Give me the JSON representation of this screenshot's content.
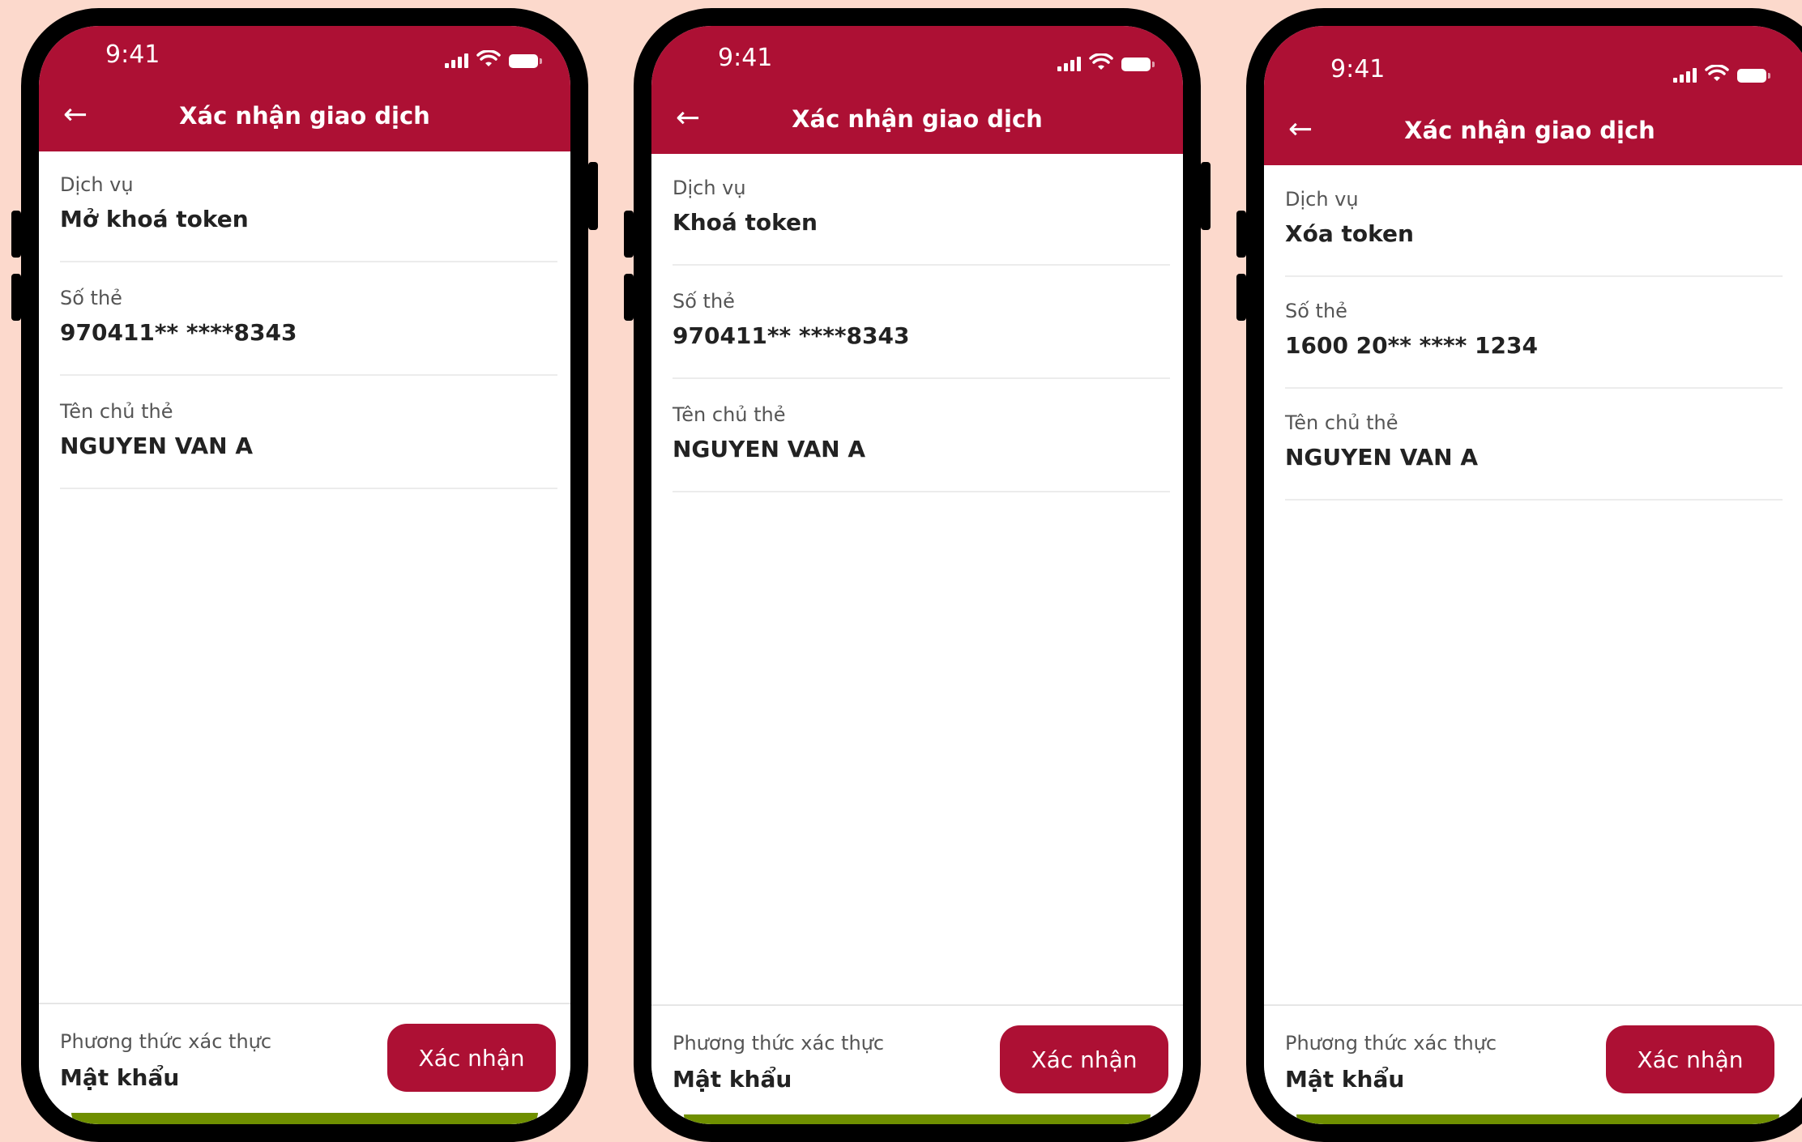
{
  "colors": {
    "background": "#fcd9cc",
    "brand": "#ad1034"
  },
  "screens": [
    {
      "status_time": "9:41",
      "title": "Xác nhận giao dịch",
      "fields": [
        {
          "label": "Dịch vụ",
          "value": "Mở khoá token"
        },
        {
          "label": "Số thẻ",
          "value": "970411** ****8343"
        },
        {
          "label": "Tên chủ thẻ",
          "value": "NGUYEN VAN A"
        }
      ],
      "auth_label": "Phương thức xác thực",
      "auth_value": "Mật khẩu",
      "confirm_label": "Xác nhận"
    },
    {
      "status_time": "9:41",
      "title": "Xác nhận giao dịch",
      "fields": [
        {
          "label": "Dịch vụ",
          "value": "Khoá token"
        },
        {
          "label": "Số thẻ",
          "value": "970411** ****8343"
        },
        {
          "label": "Tên chủ thẻ",
          "value": "NGUYEN VAN A"
        }
      ],
      "auth_label": "Phương thức xác thực",
      "auth_value": "Mật khẩu",
      "confirm_label": "Xác nhận"
    },
    {
      "status_time": "9:41",
      "title": "Xác nhận giao dịch",
      "fields": [
        {
          "label": "Dịch vụ",
          "value": "Xóa token"
        },
        {
          "label": "Số thẻ",
          "value": "1600 20** **** 1234"
        },
        {
          "label": "Tên chủ thẻ",
          "value": "NGUYEN VAN A"
        }
      ],
      "auth_label": "Phương thức xác thực",
      "auth_value": "Mật khẩu",
      "confirm_label": "Xác nhận"
    }
  ]
}
